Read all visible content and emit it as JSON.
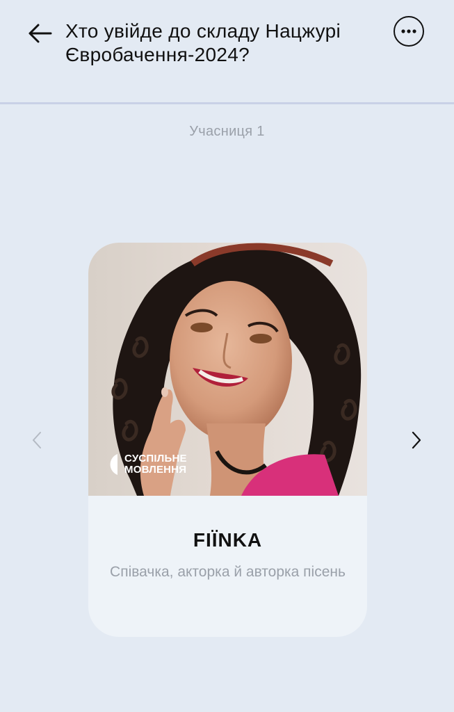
{
  "header": {
    "title": "Хто увійде до складу Нацжурі Євробачення-2024?",
    "back_icon": "arrow-left-icon",
    "more_icon": "more-horizontal-icon"
  },
  "carousel": {
    "participant_label": "Учасниця 1",
    "prev_icon": "chevron-left-icon",
    "next_icon": "chevron-right-icon",
    "prev_enabled": false,
    "next_enabled": true
  },
  "card": {
    "logo_text": "СУСПІЛЬНЕ МОВЛЕННЯ",
    "name": "FIЇNKA",
    "description": "Співачка, акторка й авторка пісень"
  },
  "colors": {
    "background": "#e3eaf3",
    "card_background": "#eef3f8",
    "muted_text": "#9aa0a9",
    "divider": "#c9d1e6"
  }
}
